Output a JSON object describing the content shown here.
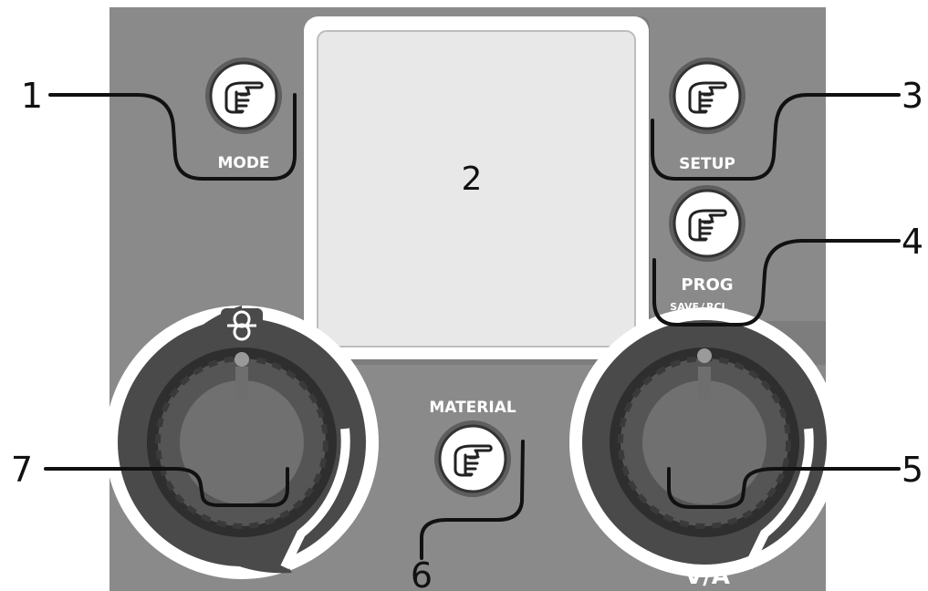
{
  "colors": {
    "panel": "#8a8a8a",
    "panel_edge": "#6f6f6f",
    "screen": "#e6e6e6",
    "screen_frame": "#ffffff",
    "knob_dark": "#2e2e2e",
    "knob_mid": "#5e5e5e",
    "knob_face": "#767676",
    "button_face": "#ffffff",
    "callout_line": "#111111"
  },
  "buttons": {
    "mode": {
      "label": "MODE",
      "icon": "pointing-hand-icon"
    },
    "setup": {
      "label": "SETUP",
      "icon": "pointing-hand-icon"
    },
    "prog": {
      "label": "PROG",
      "sublabel_save": "SAVE",
      "sublabel_sep": "/",
      "sublabel_rcl": "RCL",
      "icon": "pointing-hand-icon"
    },
    "material": {
      "label": "MATERIAL",
      "icon": "pointing-hand-icon"
    }
  },
  "knobs": {
    "left": {
      "icon": "wire-spool-icon"
    },
    "right": {
      "label": "V/A"
    }
  },
  "screen": {
    "label": "2"
  },
  "callouts": {
    "c1": "1",
    "c3": "3",
    "c4": "4",
    "c5": "5",
    "c6": "6",
    "c7": "7"
  }
}
